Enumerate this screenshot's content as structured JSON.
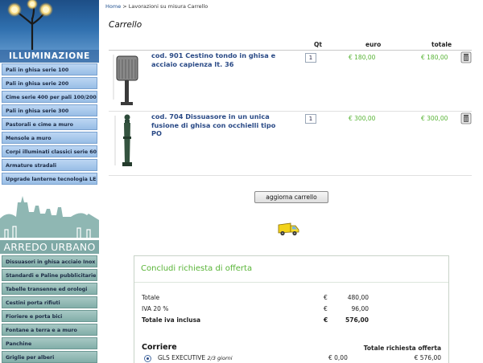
{
  "sidebar": {
    "illuminazione_title": "ILLUMINAZIONE",
    "illuminazione_items": [
      "Pali in ghisa serie 100",
      "Pali in ghisa serie 200",
      "Cime serie 400 per pali 100/200",
      "Pali in ghisa serie 300",
      "Pastorali e cime a muro",
      "Mensole a muro",
      "Corpi illuminati classici serie 600",
      "Armature stradali",
      "Upgrade lanterne tecnologia LED"
    ],
    "arredo_title": "ARREDO URBANO",
    "arredo_items": [
      "Dissuasori in ghisa acciaio Inox",
      "Standardi e Paline pubblicitarie",
      "Tabelle transenne ed orologi",
      "Cestini porta rifiuti",
      "Fioriere e porta bici",
      "Fontane a terra e a muro",
      "Panchine",
      "Griglie per alberi"
    ]
  },
  "breadcrumb": {
    "home": "Home",
    "rest": " > Lavorazioni su misura Carrello"
  },
  "page_title": "Carrello",
  "cart": {
    "headers": {
      "qty": "Qt",
      "price": "euro",
      "total": "totale"
    },
    "items": [
      {
        "name": "cod. 901   Cestino tondo in ghisa e acciaio capienza lt. 36",
        "qty": "1",
        "price": "€ 180,00",
        "total": "€ 180,00"
      },
      {
        "name": "cod. 704   Dissuasore in un unica fusione di ghisa con occhielli tipo PO",
        "qty": "1",
        "price": "€ 300,00",
        "total": "€ 300,00"
      }
    ],
    "update_label": "aggiorna carrello"
  },
  "offer": {
    "title": "Concludi richiesta di offerta",
    "summary": [
      {
        "label": "Totale",
        "currency": "€",
        "value": "480,00"
      },
      {
        "label": "IVA 20 %",
        "currency": "€",
        "value": "96,00"
      },
      {
        "label": "Totale iva inclusa",
        "currency": "€",
        "value": "576,00"
      }
    ],
    "courier_title": "Corriere",
    "total_offer_label": "Totale richiesta offerta",
    "courier": {
      "name": "GLS EXECUTIVE",
      "time": "2/3 giorni",
      "cost": "€ 0,00",
      "grand_total": "€ 576,00"
    }
  },
  "colors": {
    "accent_green": "#58b436",
    "link_blue": "#2a4a86",
    "illum_menu": "#a8c8ee",
    "arredo_menu": "#8fb7b3"
  }
}
